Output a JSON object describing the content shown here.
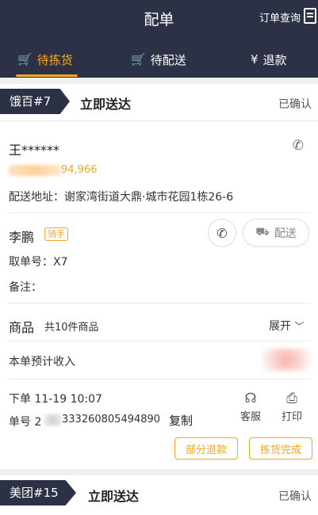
{
  "header": {
    "title": "配单",
    "query_label": "订单查询"
  },
  "tabs": [
    {
      "label": "待拣货",
      "icon": "cart-icon",
      "glyph": "🛒"
    },
    {
      "label": "待配送",
      "icon": "delivery-cart-icon",
      "glyph": "🛒"
    },
    {
      "label": "退款",
      "icon": "refund-icon",
      "glyph": "¥"
    }
  ],
  "colors": {
    "header_bg": "#2d3146",
    "accent": "#f5a623"
  },
  "order1": {
    "badge": "饿百#7",
    "delivery_type": "立即送达",
    "status": "已确认",
    "customer_name": "王******",
    "customer_phone_tail": "94,966",
    "address": "配送地址：谢家湾街道大鼎·城市花园1栋26-6",
    "rider_name": "李鹏",
    "rider_tag": "骑手",
    "dispatch_label": "配送",
    "pickup_no": "取单号：X7",
    "remark": "备注：",
    "goods_label": "商品",
    "goods_count": "共10件商品",
    "expand_label": "展开",
    "income_label": "本单预计收入",
    "order_time": "下单 11-19 10:07",
    "order_no_prefix": "单号 2",
    "order_no_suffix": "333260805494890",
    "copy_label": "复制",
    "service_label": "客服",
    "print_label": "打印",
    "partial_refund_label": "部分退款",
    "picking_done_label": "拣货完成"
  },
  "order2": {
    "badge": "美团#15",
    "delivery_type": "立即送达",
    "status": "已确认"
  }
}
